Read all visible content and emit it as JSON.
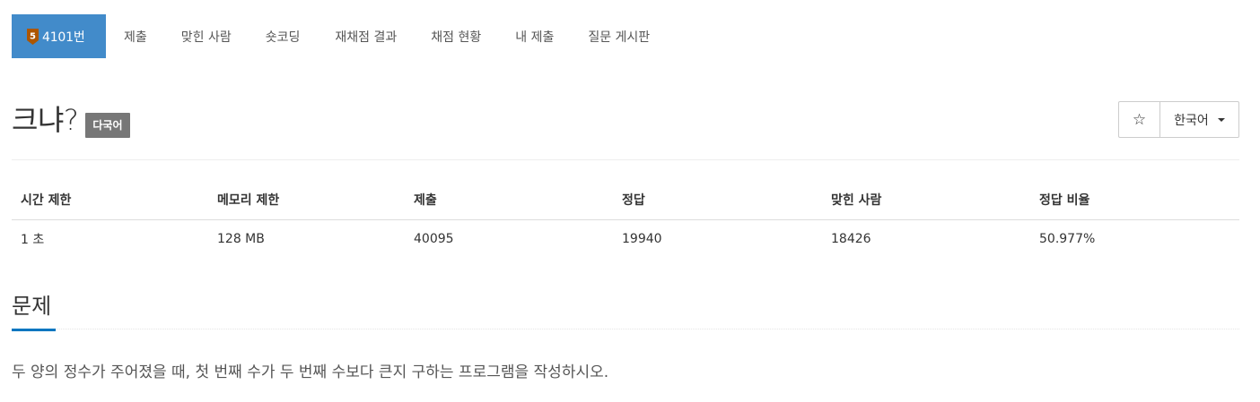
{
  "menu": {
    "active": {
      "number_label": "4101번",
      "tier_icon": "bronze-5-tier-icon",
      "tier_text": "5",
      "tier_color": "#ad5600"
    },
    "items": [
      {
        "label": "제출",
        "name": "menu-submit"
      },
      {
        "label": "맞힌 사람",
        "name": "menu-solved-users"
      },
      {
        "label": "숏코딩",
        "name": "menu-short-coding"
      },
      {
        "label": "재채점 결과",
        "name": "menu-rejudge-results"
      },
      {
        "label": "채점 현황",
        "name": "menu-judge-status"
      },
      {
        "label": "내 제출",
        "name": "menu-my-submissions"
      },
      {
        "label": "질문 게시판",
        "name": "menu-question-board"
      }
    ]
  },
  "problem": {
    "title": "크냐?",
    "multilang_label": "다국어"
  },
  "toolbar": {
    "star_icon": "star-outline-icon",
    "star_glyph": "☆",
    "language_label": "한국어"
  },
  "info_table": {
    "headers": [
      "시간 제한",
      "메모리 제한",
      "제출",
      "정답",
      "맞힌 사람",
      "정답 비율"
    ],
    "values": [
      "1 초",
      "128 MB",
      "40095",
      "19940",
      "18426",
      "50.977%"
    ]
  },
  "section": {
    "heading": "문제",
    "body": "두 양의 정수가 주어졌을 때, 첫 번째 수가 두 번째 수보다 큰지 구하는 프로그램을 작성하시오."
  },
  "colors": {
    "active_tab": "#428bca",
    "section_underline": "#0076c0",
    "language_badge": "#777777"
  }
}
